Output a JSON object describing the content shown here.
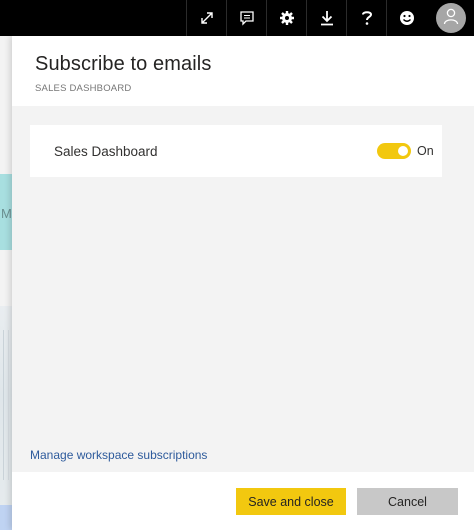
{
  "topbar": {
    "buttons": [
      {
        "icon": "expand-icon"
      },
      {
        "icon": "comment-icon"
      },
      {
        "icon": "gear-icon"
      },
      {
        "icon": "download-icon"
      },
      {
        "icon": "help-icon"
      },
      {
        "icon": "smiley-icon"
      }
    ],
    "avatar_icon": "user-icon"
  },
  "background": {
    "letter": "M"
  },
  "panel": {
    "title": "Subscribe to emails",
    "subtitle": "SALES DASHBOARD",
    "subscription": {
      "label": "Sales Dashboard",
      "toggle_state": "On",
      "toggle_on": true
    },
    "manage_link": "Manage workspace subscriptions",
    "buttons": {
      "save": "Save and close",
      "cancel": "Cancel"
    }
  },
  "colors": {
    "accent": "#f2c80f",
    "link": "#2e5b9c",
    "topbar": "#000000",
    "panel_bg": "#f3f3f3",
    "cancel_bg": "#c8c8c8"
  }
}
